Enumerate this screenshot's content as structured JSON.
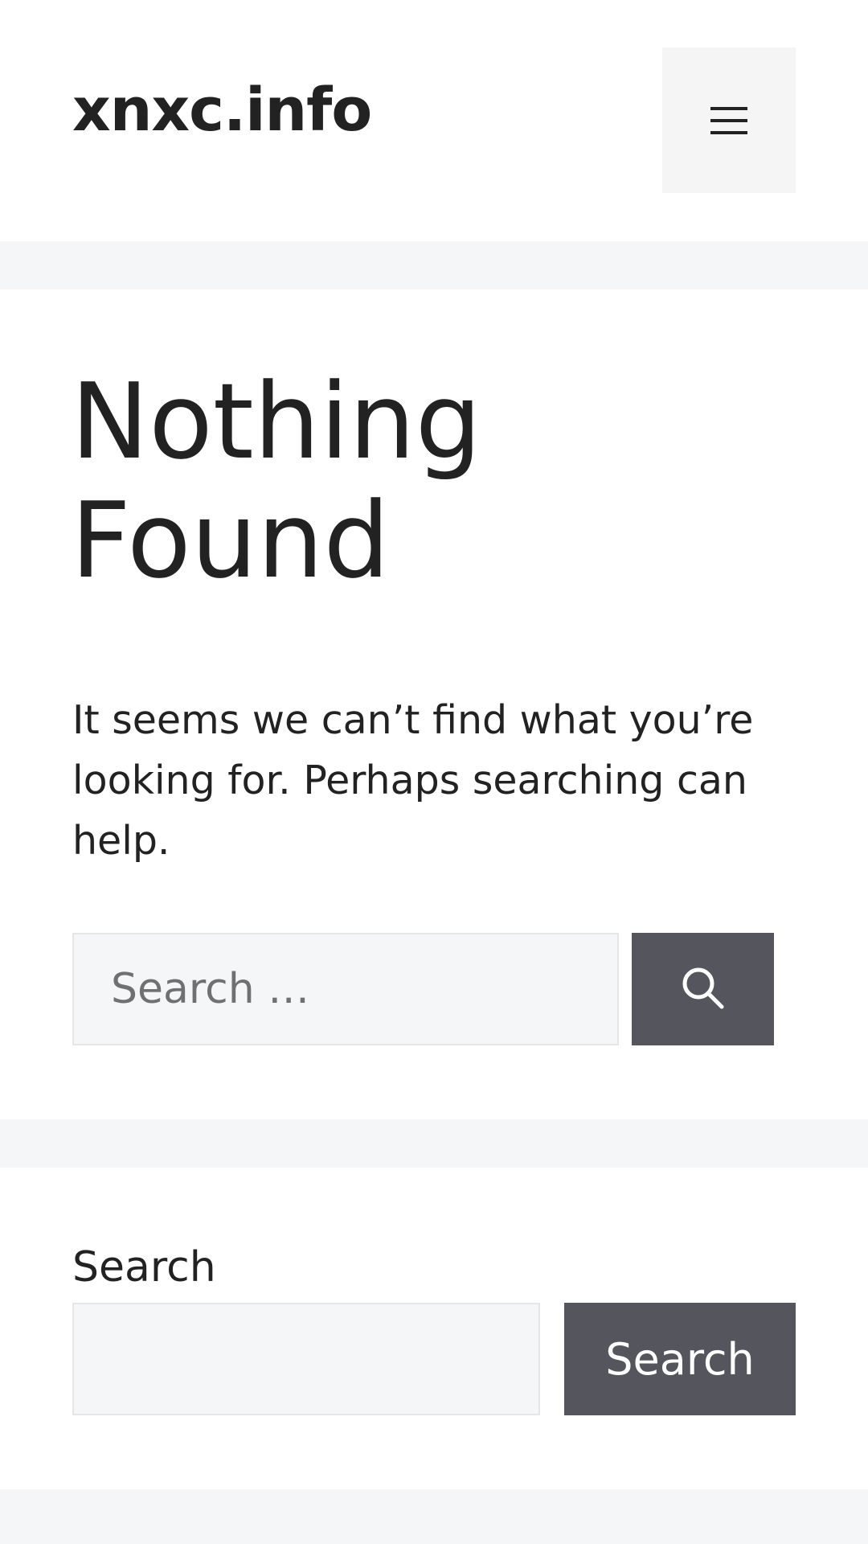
{
  "header": {
    "site_title": "xnxc.info",
    "menu_icon": "hamburger-menu-icon"
  },
  "main": {
    "title": "Nothing Found",
    "description": "It seems we can’t find what you’re looking for. Perhaps searching can help.",
    "search": {
      "placeholder": "Search …",
      "value": "",
      "submit_icon": "search-icon"
    }
  },
  "widget": {
    "label": "Search",
    "input_value": "",
    "button_label": "Search"
  },
  "colors": {
    "page_background": "#f5f6f8",
    "button_background": "#55555e",
    "text": "#222222"
  }
}
